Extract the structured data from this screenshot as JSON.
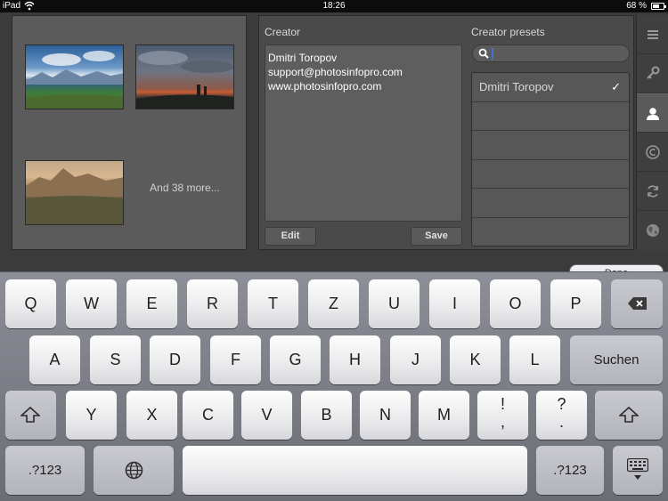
{
  "status_bar": {
    "device": "iPad",
    "time": "18:26",
    "battery": "68 %",
    "battery_level": 0.68
  },
  "thumbnails": {
    "more_label": "And 38 more..."
  },
  "creator": {
    "heading": "Creator",
    "lines": [
      "Dmitri Toropov",
      "support@photosinfopro.com",
      "www.photosinfopro.com"
    ],
    "edit_label": "Edit",
    "save_label": "Save"
  },
  "presets": {
    "heading": "Creator presets",
    "search_value": "",
    "items": [
      {
        "label": "Dmitri Toropov",
        "selected": true
      },
      {
        "label": ""
      },
      {
        "label": ""
      },
      {
        "label": ""
      },
      {
        "label": ""
      },
      {
        "label": ""
      }
    ],
    "check_mark": "✓"
  },
  "side_tabs": [
    {
      "icon": "menu-icon"
    },
    {
      "icon": "key-icon"
    },
    {
      "icon": "user-icon",
      "active": true
    },
    {
      "icon": "copyright-icon"
    },
    {
      "icon": "sync-icon"
    },
    {
      "icon": "globe-icon"
    }
  ],
  "done_label": "Done",
  "keyboard": {
    "row1": [
      "Q",
      "W",
      "E",
      "R",
      "T",
      "Z",
      "U",
      "I",
      "O",
      "P"
    ],
    "row2": [
      "A",
      "S",
      "D",
      "F",
      "G",
      "H",
      "J",
      "K",
      "L"
    ],
    "row2_action": "Suchen",
    "row3": [
      "Y",
      "X",
      "C",
      "V",
      "B",
      "N",
      "M"
    ],
    "punct1": [
      "!",
      ","
    ],
    "punct2": [
      "?",
      "."
    ],
    "numbers_label": ".?123"
  }
}
